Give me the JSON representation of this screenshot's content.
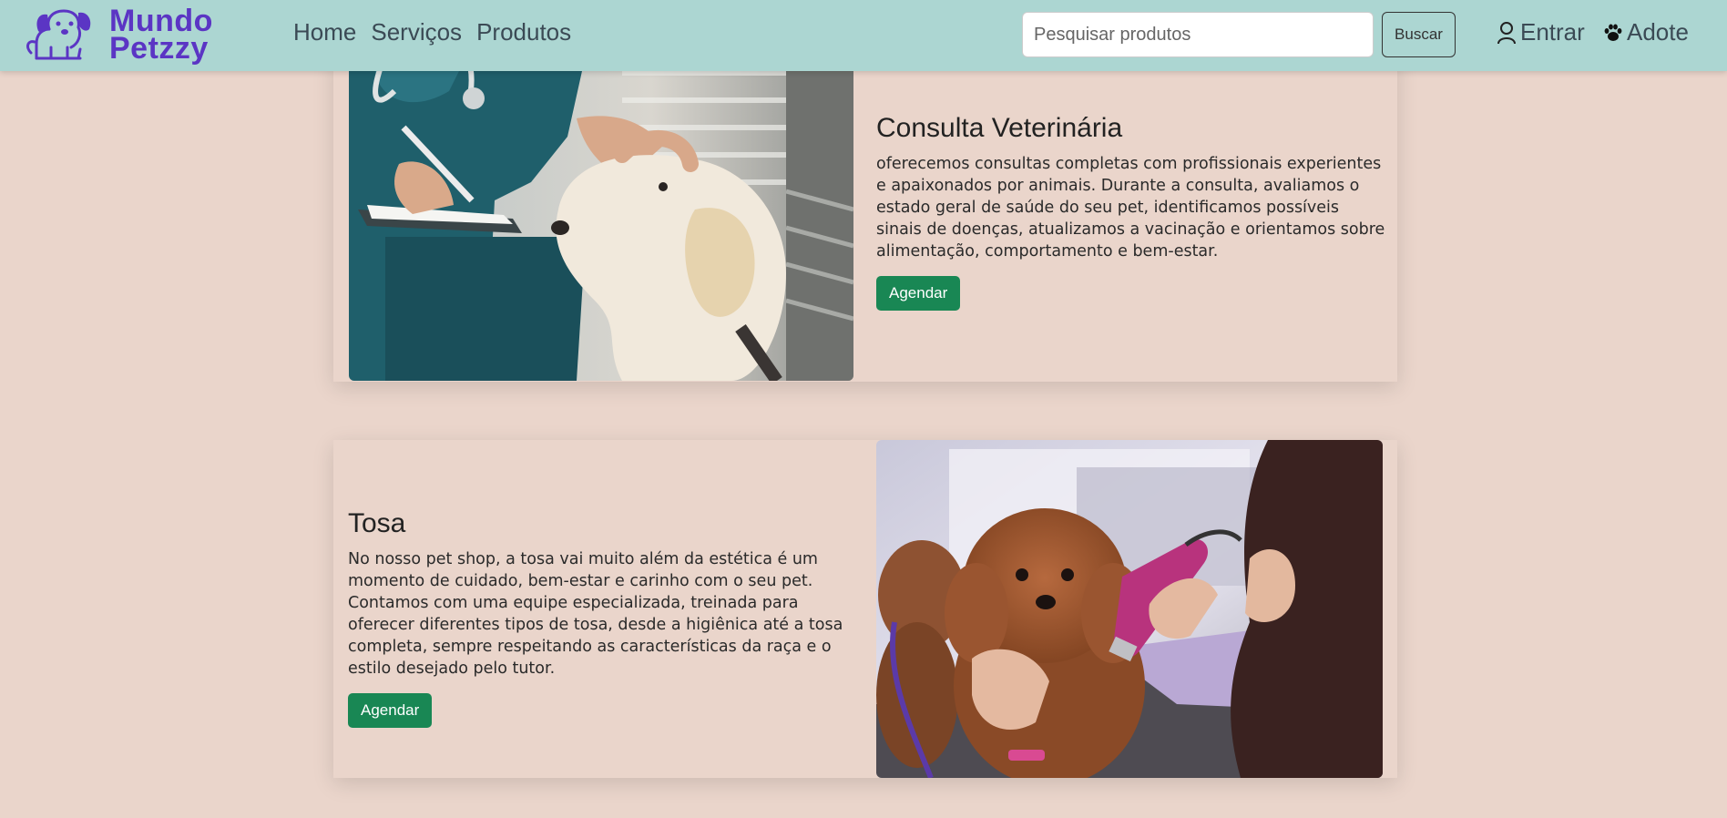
{
  "brand": {
    "line1": "Mundo",
    "line2": "Petzzy",
    "color": "#5b35c4"
  },
  "nav": {
    "home": "Home",
    "services": "Serviços",
    "products": "Produtos"
  },
  "search": {
    "placeholder": "Pesquisar produtos",
    "button": "Buscar"
  },
  "user_menu": {
    "login": "Entrar",
    "login_icon": "user-icon",
    "adopt": "Adote",
    "adopt_icon": "paw-icon"
  },
  "services": [
    {
      "title": "Consulta Veterinária",
      "description": "oferecemos consultas completas com profissionais experientes e apaixonados por animais. Durante a consulta, avaliamos o estado geral de saúde do seu pet, identificamos possíveis sinais de doenças, atualizamos a vacinação e orientamos sobre alimentação, comportamento e bem-estar.",
      "button": "Agendar",
      "image": "veterinarian-with-labrador-photo"
    },
    {
      "title": "Tosa",
      "description": "No nosso pet shop, a tosa vai muito além da estética é um momento de cuidado, bem-estar e carinho com o seu pet. Contamos com uma equipe especializada, treinada para oferecer diferentes tipos de tosa, desde a higiênica até a tosa completa, sempre respeitando as características da raça e o estilo desejado pelo tutor.",
      "button": "Agendar",
      "image": "poodle-grooming-photo"
    }
  ],
  "colors": {
    "navbar": "#acd6d2",
    "background": "#ead5cb",
    "button_green": "#198754"
  }
}
